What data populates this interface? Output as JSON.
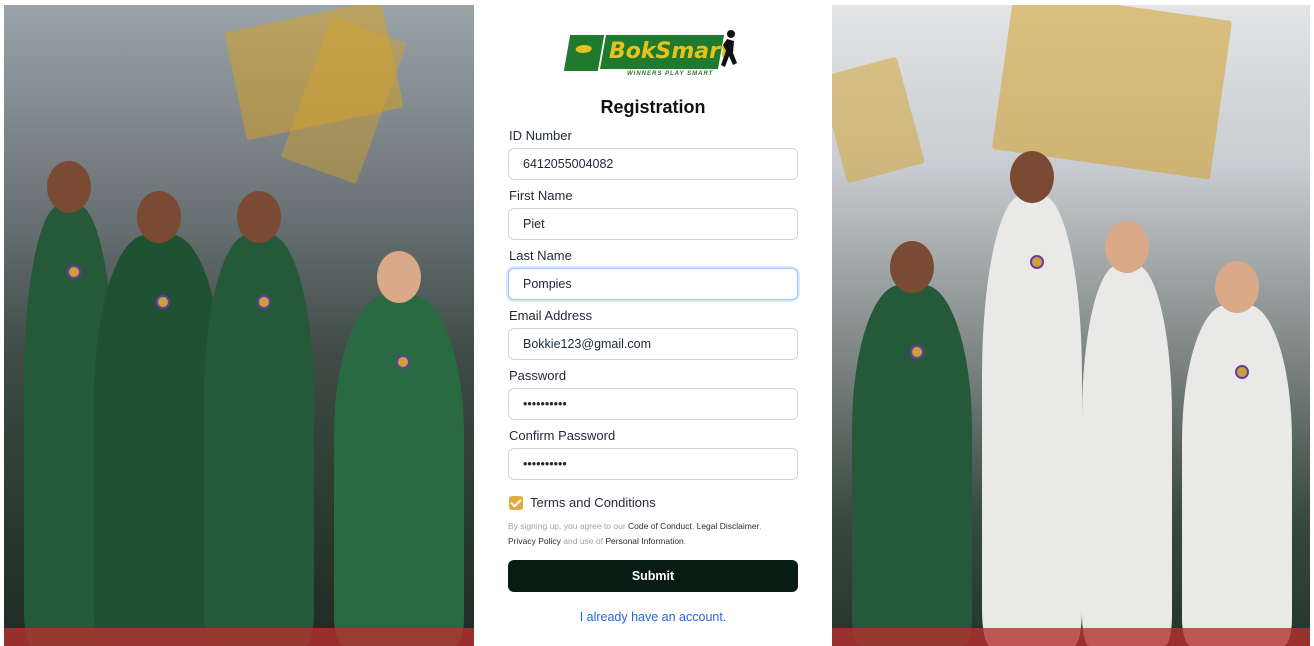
{
  "brand": {
    "logo_word": "BokSmart",
    "logo_tagline": "WINNERS PLAY SMART",
    "colors": {
      "green": "#1f7a2e",
      "gold": "#e8c21c",
      "checkbox": "#e3a93b",
      "submit_bg": "#081c14",
      "link": "#2563eb"
    }
  },
  "form": {
    "title": "Registration",
    "fields": {
      "id_number": {
        "label": "ID Number",
        "value": "6412055004082"
      },
      "first_name": {
        "label": "First Name",
        "value": "Piet"
      },
      "last_name": {
        "label": "Last Name",
        "value": "Pompies"
      },
      "email": {
        "label": "Email Address",
        "value": "Bokkie123@gmail.com"
      },
      "password": {
        "label": "Password",
        "value": "••••••••••"
      },
      "confirm_password": {
        "label": "Confirm Password",
        "value": "••••••••••"
      }
    },
    "terms": {
      "label": "Terms and Conditions",
      "checked": true,
      "legal_intro": "By signing up, you agree to our",
      "code_of_conduct": "Code of Conduct",
      "comma": ",",
      "legal_disclaimer": "Legal Disclaimer",
      "comma2": ",",
      "privacy_policy": "Privacy Policy",
      "and_use_of": "and use of",
      "personal_information": "Personal Information",
      "period": "."
    },
    "submit_label": "Submit",
    "signin_link": "I already have an account."
  },
  "background": {
    "left_icon": "team-celebration-photo",
    "right_icon": "team-celebration-photo"
  }
}
